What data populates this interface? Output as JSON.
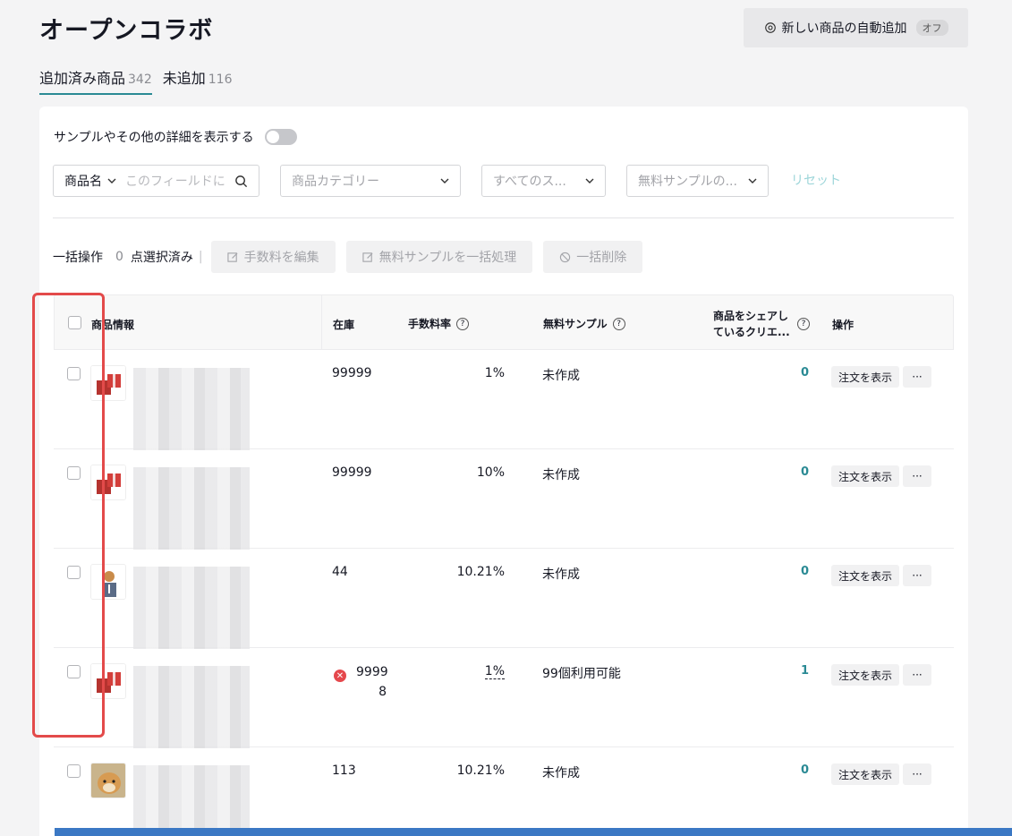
{
  "header": {
    "title": "オープンコラボ",
    "auto_add_label": "新しい商品の自動追加",
    "auto_add_state": "オフ"
  },
  "tabs": [
    {
      "label": "追加済み商品",
      "count": "342",
      "active": true
    },
    {
      "label": "未追加",
      "count": "116",
      "active": false
    }
  ],
  "details_toggle_label": "サンプルやその他の詳細を表示する",
  "filters": {
    "name_select": "商品名",
    "name_placeholder": "このフィールドに",
    "category_placeholder": "商品カテゴリー",
    "status_placeholder": "すべてのス...",
    "sample_placeholder": "無料サンプルの...",
    "reset_label": "リセット"
  },
  "bulk": {
    "label": "一括操作",
    "count": "0",
    "selected_suffix": "点選択済み",
    "separator": "|",
    "edit_fee": "手数料を編集",
    "bulk_sample": "無料サンプルを一括処理",
    "bulk_delete": "一括削除"
  },
  "table": {
    "headers": {
      "product": "商品情報",
      "stock": "在庫",
      "rate": "手数料率",
      "sample": "無料サンプル",
      "creators": "商品をシェアしているクリエ...",
      "actions": "操作"
    },
    "order_button": "注文を表示",
    "more_button": "···",
    "rows": [
      {
        "stock": "99999",
        "rate": "1%",
        "sample": "未作成",
        "creators": "0",
        "thumb": "gift"
      },
      {
        "stock": "99999",
        "rate": "10%",
        "sample": "未作成",
        "creators": "0",
        "thumb": "gift"
      },
      {
        "stock": "44",
        "rate": "10.21%",
        "sample": "未作成",
        "creators": "0",
        "thumb": "person"
      },
      {
        "stock": "99998",
        "stock_line1": "9999",
        "stock_line2": "8",
        "rate": "1%",
        "sample": "99個利用可能",
        "creators": "1",
        "thumb": "gift",
        "error": true
      },
      {
        "stock": "113",
        "rate": "10.21%",
        "sample": "未作成",
        "creators": "0",
        "thumb": "dog"
      }
    ]
  },
  "colors": {
    "accent": "#2a8a94",
    "highlight": "#e34a4a",
    "error": "#e5484d"
  }
}
